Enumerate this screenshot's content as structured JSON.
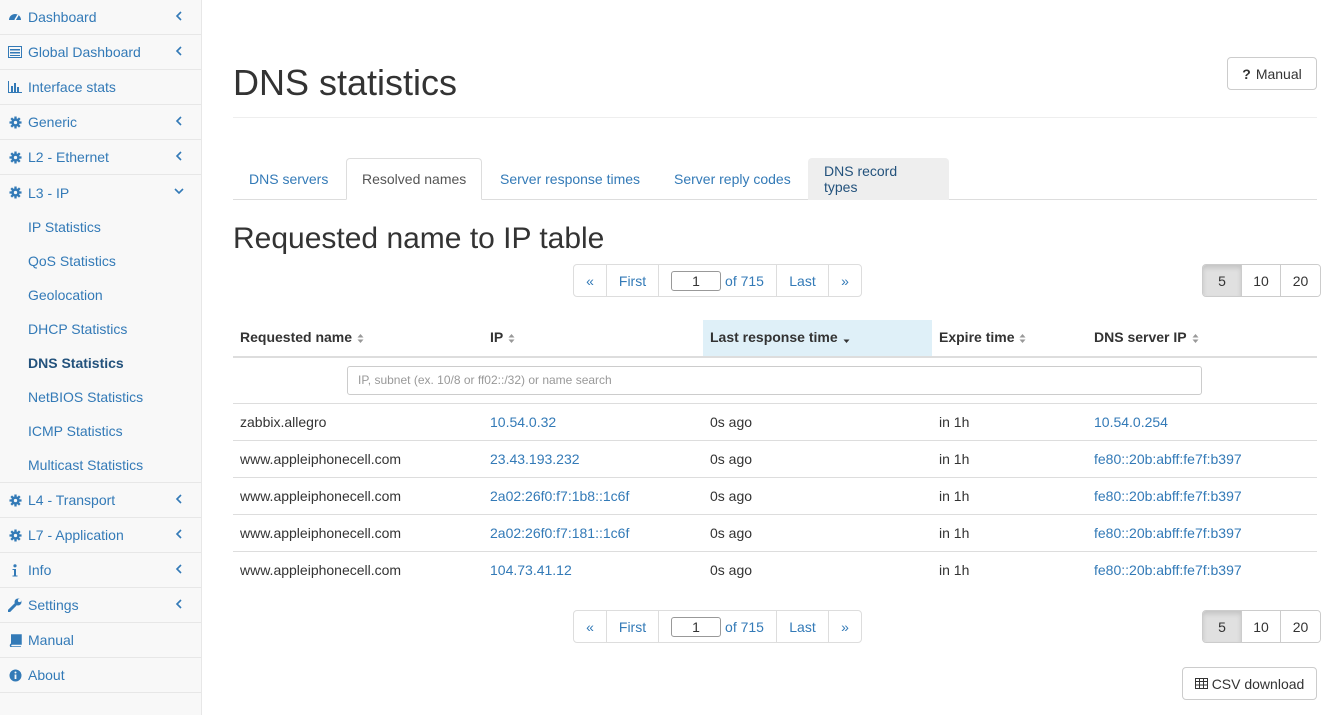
{
  "sidebar": {
    "items": [
      {
        "label": "Dashboard",
        "icon": "dashboard-icon",
        "chevron": "left"
      },
      {
        "label": "Global Dashboard",
        "icon": "list-icon",
        "chevron": "left"
      },
      {
        "label": "Interface stats",
        "icon": "bar-chart-icon",
        "chevron": ""
      },
      {
        "label": "Generic",
        "icon": "gear-icon",
        "chevron": "left"
      },
      {
        "label": "L2 - Ethernet",
        "icon": "gear-icon",
        "chevron": "left"
      },
      {
        "label": "L3 - IP",
        "icon": "gear-icon",
        "chevron": "down"
      }
    ],
    "sub_items": [
      {
        "label": "IP Statistics"
      },
      {
        "label": "QoS Statistics"
      },
      {
        "label": "Geolocation"
      },
      {
        "label": "DHCP Statistics"
      },
      {
        "label": "DNS Statistics",
        "active": true
      },
      {
        "label": "NetBIOS Statistics"
      },
      {
        "label": "ICMP Statistics"
      },
      {
        "label": "Multicast Statistics"
      }
    ],
    "items_after": [
      {
        "label": "L4 - Transport",
        "icon": "gear-icon",
        "chevron": "left"
      },
      {
        "label": "L7 - Application",
        "icon": "gear-icon",
        "chevron": "left"
      },
      {
        "label": "Info",
        "icon": "info-icon",
        "chevron": "left"
      },
      {
        "label": "Settings",
        "icon": "wrench-icon",
        "chevron": "left"
      },
      {
        "label": "Manual",
        "icon": "book-icon",
        "chevron": ""
      },
      {
        "label": "About",
        "icon": "info-circle-icon",
        "chevron": ""
      }
    ]
  },
  "header": {
    "title": "DNS statistics",
    "manual_label": "Manual",
    "manual_glyph": "?"
  },
  "tabs": [
    {
      "label": "DNS servers"
    },
    {
      "label": "Resolved names",
      "active": true
    },
    {
      "label": "Server response times"
    },
    {
      "label": "Server reply codes"
    },
    {
      "label": "DNS record types",
      "hover": true
    }
  ],
  "section": {
    "title": "Requested name to IP table"
  },
  "pagination": {
    "prev": "«",
    "first": "First",
    "page": "1",
    "of": "of 715",
    "last": "Last",
    "next": "»"
  },
  "page_sizes": [
    "5",
    "10",
    "20"
  ],
  "page_size_active": "5",
  "table": {
    "columns": [
      "Requested name",
      "IP",
      "Last response time",
      "Expire time",
      "DNS server IP"
    ],
    "sorted_column": "Last response time",
    "filter_placeholder": "IP, subnet (ex. 10/8 or ff02::/32) or name search",
    "rows": [
      {
        "name": "zabbix.allegro",
        "ip": "10.54.0.32",
        "last": "0s ago",
        "expire": "in 1h",
        "dns": "10.54.0.254"
      },
      {
        "name": "www.appleiphonecell.com",
        "ip": "23.43.193.232",
        "last": "0s ago",
        "expire": "in 1h",
        "dns": "fe80::20b:abff:fe7f:b397"
      },
      {
        "name": "www.appleiphonecell.com",
        "ip": "2a02:26f0:f7:1b8::1c6f",
        "last": "0s ago",
        "expire": "in 1h",
        "dns": "fe80::20b:abff:fe7f:b397"
      },
      {
        "name": "www.appleiphonecell.com",
        "ip": "2a02:26f0:f7:181::1c6f",
        "last": "0s ago",
        "expire": "in 1h",
        "dns": "fe80::20b:abff:fe7f:b397"
      },
      {
        "name": "www.appleiphonecell.com",
        "ip": "104.73.41.12",
        "last": "0s ago",
        "expire": "in 1h",
        "dns": "fe80::20b:abff:fe7f:b397"
      }
    ]
  },
  "csv_label": "CSV download",
  "colors": {
    "link": "#337ab7",
    "sorted_header_bg": "#dff0f8"
  }
}
